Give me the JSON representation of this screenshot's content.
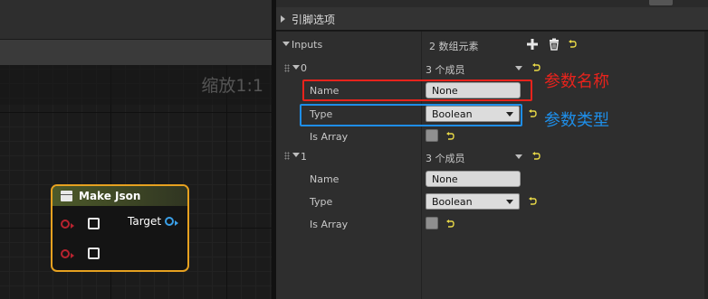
{
  "graph": {
    "zoom_label": "缩放1:1",
    "node": {
      "title": "Make Json",
      "output_pin_label": "Target",
      "header_color": "#4d5a2a",
      "border_color": "#e6a120"
    }
  },
  "details": {
    "section_title": "引脚选项",
    "inputs": {
      "label": "Inputs",
      "count_text": "2 数组元素",
      "add_icon": "plus-icon",
      "delete_icon": "trash-icon",
      "reset_icon": "reset-arrow-icon"
    },
    "elements": [
      {
        "index": "0",
        "members_text": "3 个成员",
        "name_label": "Name",
        "name_value": "None",
        "type_label": "Type",
        "type_value": "Boolean",
        "is_array_label": "Is Array",
        "is_array_checked": false
      },
      {
        "index": "1",
        "members_text": "3 个成员",
        "name_label": "Name",
        "name_value": "None",
        "type_label": "Type",
        "type_value": "Boolean",
        "is_array_label": "Is Array",
        "is_array_checked": false
      }
    ]
  },
  "annotations": {
    "name_note": "参数名称",
    "name_color": "#e8231c",
    "type_note": "参数类型",
    "type_color": "#1e8ee8"
  }
}
